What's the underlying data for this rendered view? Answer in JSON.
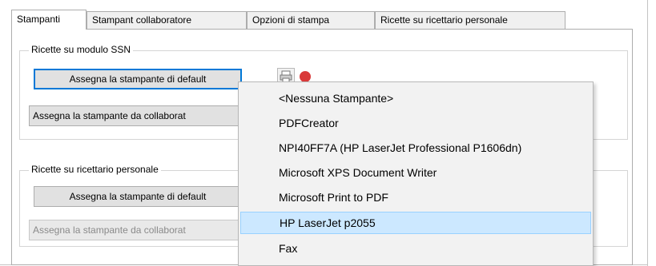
{
  "tabs": [
    {
      "label": "Stampanti",
      "active": true
    },
    {
      "label": "Stampant collaboratore",
      "active": false
    },
    {
      "label": "Opzioni di stampa",
      "active": false
    },
    {
      "label": "Ricette su ricettario personale",
      "active": false
    }
  ],
  "group_ssn": {
    "title": "Ricette su modulo SSN",
    "default_button": "Assegna la stampante di default",
    "collab_button": "Assegna la stampante da collaborat"
  },
  "group_personal": {
    "title": "Ricette su ricettario personale",
    "default_button": "Assegna la stampante di default",
    "collab_button": "Assegna la stampante da collaborat"
  },
  "printer_menu": {
    "items": [
      {
        "label": "<Nessuna Stampante>"
      },
      {
        "label": "PDFCreator"
      },
      {
        "label": "NPI40FF7A (HP LaserJet Professional P1606dn)"
      },
      {
        "label": "Microsoft XPS Document Writer"
      },
      {
        "label": "Microsoft Print to PDF"
      },
      {
        "label": "HP LaserJet p2055",
        "selected": true
      },
      {
        "label": "Fax"
      }
    ]
  },
  "icons": {
    "printer_settings": "printer-icon",
    "remove": "remove-icon"
  },
  "colors": {
    "selection_fill": "#cce8ff",
    "selection_border": "#99d1ff",
    "focus_border": "#0078d7",
    "remove_icon": "#d93a3a"
  }
}
